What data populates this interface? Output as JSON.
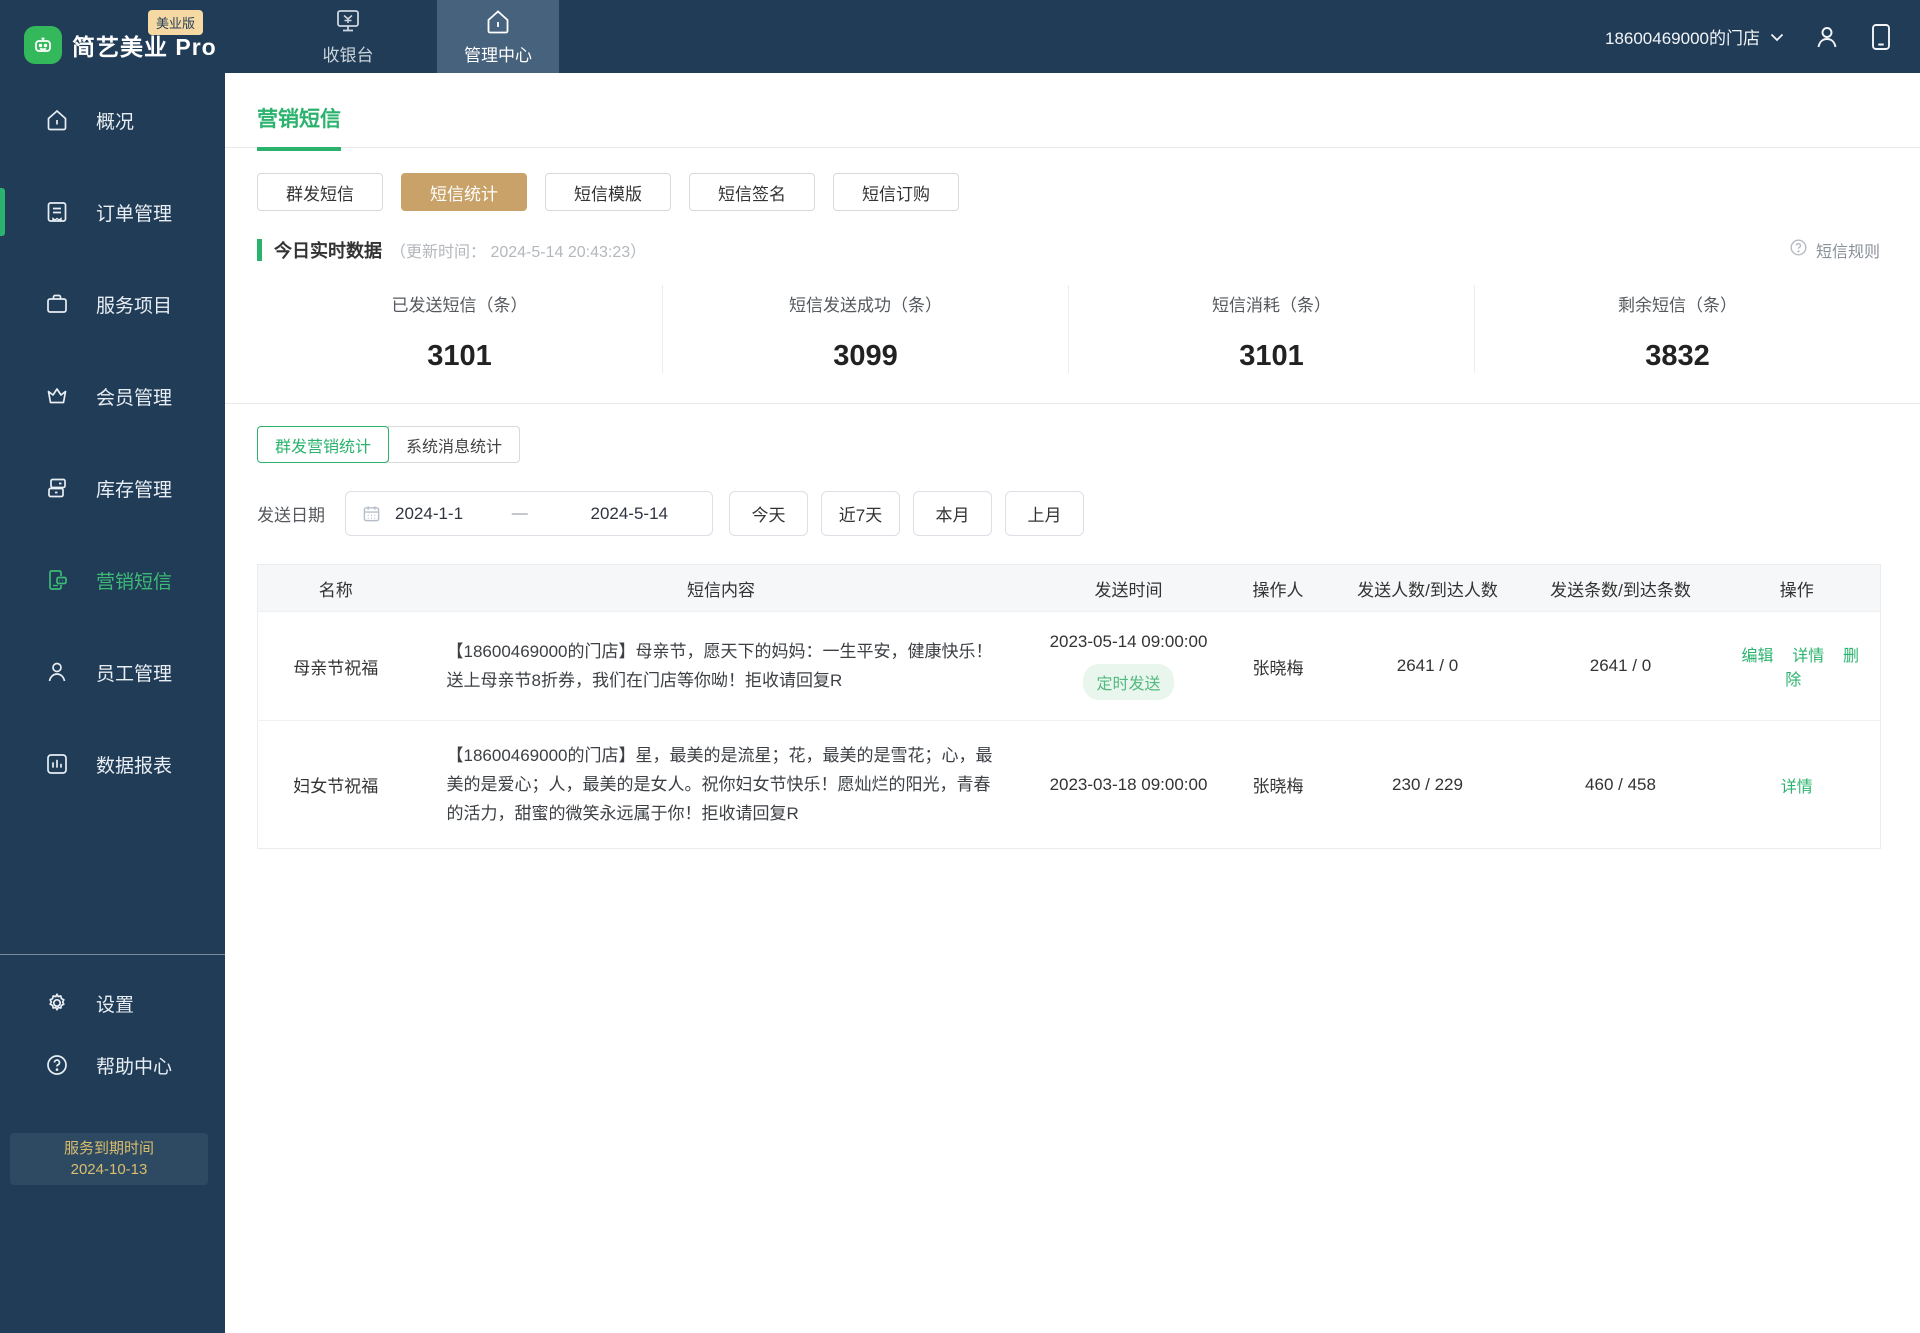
{
  "app": {
    "name": "简艺美业 Pro",
    "badge": "美业版"
  },
  "topnav": {
    "cashier": "收银台",
    "admin": "管理中心",
    "store": "18600469000的门店"
  },
  "sidebar": {
    "items": [
      {
        "label": "概况"
      },
      {
        "label": "订单管理"
      },
      {
        "label": "服务项目"
      },
      {
        "label": "会员管理"
      },
      {
        "label": "库存管理"
      },
      {
        "label": "营销短信"
      },
      {
        "label": "员工管理"
      },
      {
        "label": "数据报表"
      }
    ],
    "footer_items": [
      {
        "label": "设置"
      },
      {
        "label": "帮助中心"
      }
    ],
    "expire": {
      "label": "服务到期时间",
      "date": "2024-10-13"
    }
  },
  "page": {
    "title": "营销短信",
    "tabs": [
      {
        "label": "群发短信"
      },
      {
        "label": "短信统计"
      },
      {
        "label": "短信模版"
      },
      {
        "label": "短信签名"
      },
      {
        "label": "短信订购"
      }
    ],
    "help_link": "短信规则"
  },
  "realtime": {
    "title": "今日实时数据",
    "update": "（更新时间： 2024-5-14 20:43:23）",
    "stats": [
      {
        "label": "已发送短信（条）",
        "value": "3101"
      },
      {
        "label": "短信发送成功（条）",
        "value": "3099"
      },
      {
        "label": "短信消耗（条）",
        "value": "3101"
      },
      {
        "label": "剩余短信（条）",
        "value": "3832"
      }
    ]
  },
  "filters": {
    "toggle": [
      {
        "label": "群发营销统计"
      },
      {
        "label": "系统消息统计"
      }
    ],
    "date_label": "发送日期",
    "date_from": "2024-1-1",
    "date_separator": "—",
    "date_to": "2024-5-14",
    "quick": [
      {
        "label": "今天"
      },
      {
        "label": "近7天"
      },
      {
        "label": "本月"
      },
      {
        "label": "上月"
      }
    ]
  },
  "table": {
    "headers": [
      "名称",
      "短信内容",
      "发送时间",
      "操作人",
      "发送人数/到达人数",
      "发送条数/到达条数",
      "操作"
    ],
    "rows": [
      {
        "name": "母亲节祝福",
        "content": "【18600469000的门店】母亲节，愿天下的妈妈：一生平安，健康快乐！送上母亲节8折券，我们在门店等你呦！拒收请回复R",
        "time": "2023-05-14 09:00:00",
        "time_badge": "定时发送",
        "operator": "张晓梅",
        "people": "2641 / 0",
        "count": "2641 / 0",
        "actions": [
          "编辑",
          "详情",
          "删除"
        ]
      },
      {
        "name": "妇女节祝福",
        "content": "【18600469000的门店】星，最美的是流星；花，最美的是雪花；心，最美的是爱心；人，最美的是女人。祝你妇女节快乐！愿灿烂的阳光，青春的活力，甜蜜的微笑永远属于你！拒收请回复R",
        "time": "2023-03-18 09:00:00",
        "operator": "张晓梅",
        "people": "230 / 229",
        "count": "460 / 458",
        "actions": [
          "详情"
        ]
      }
    ]
  }
}
